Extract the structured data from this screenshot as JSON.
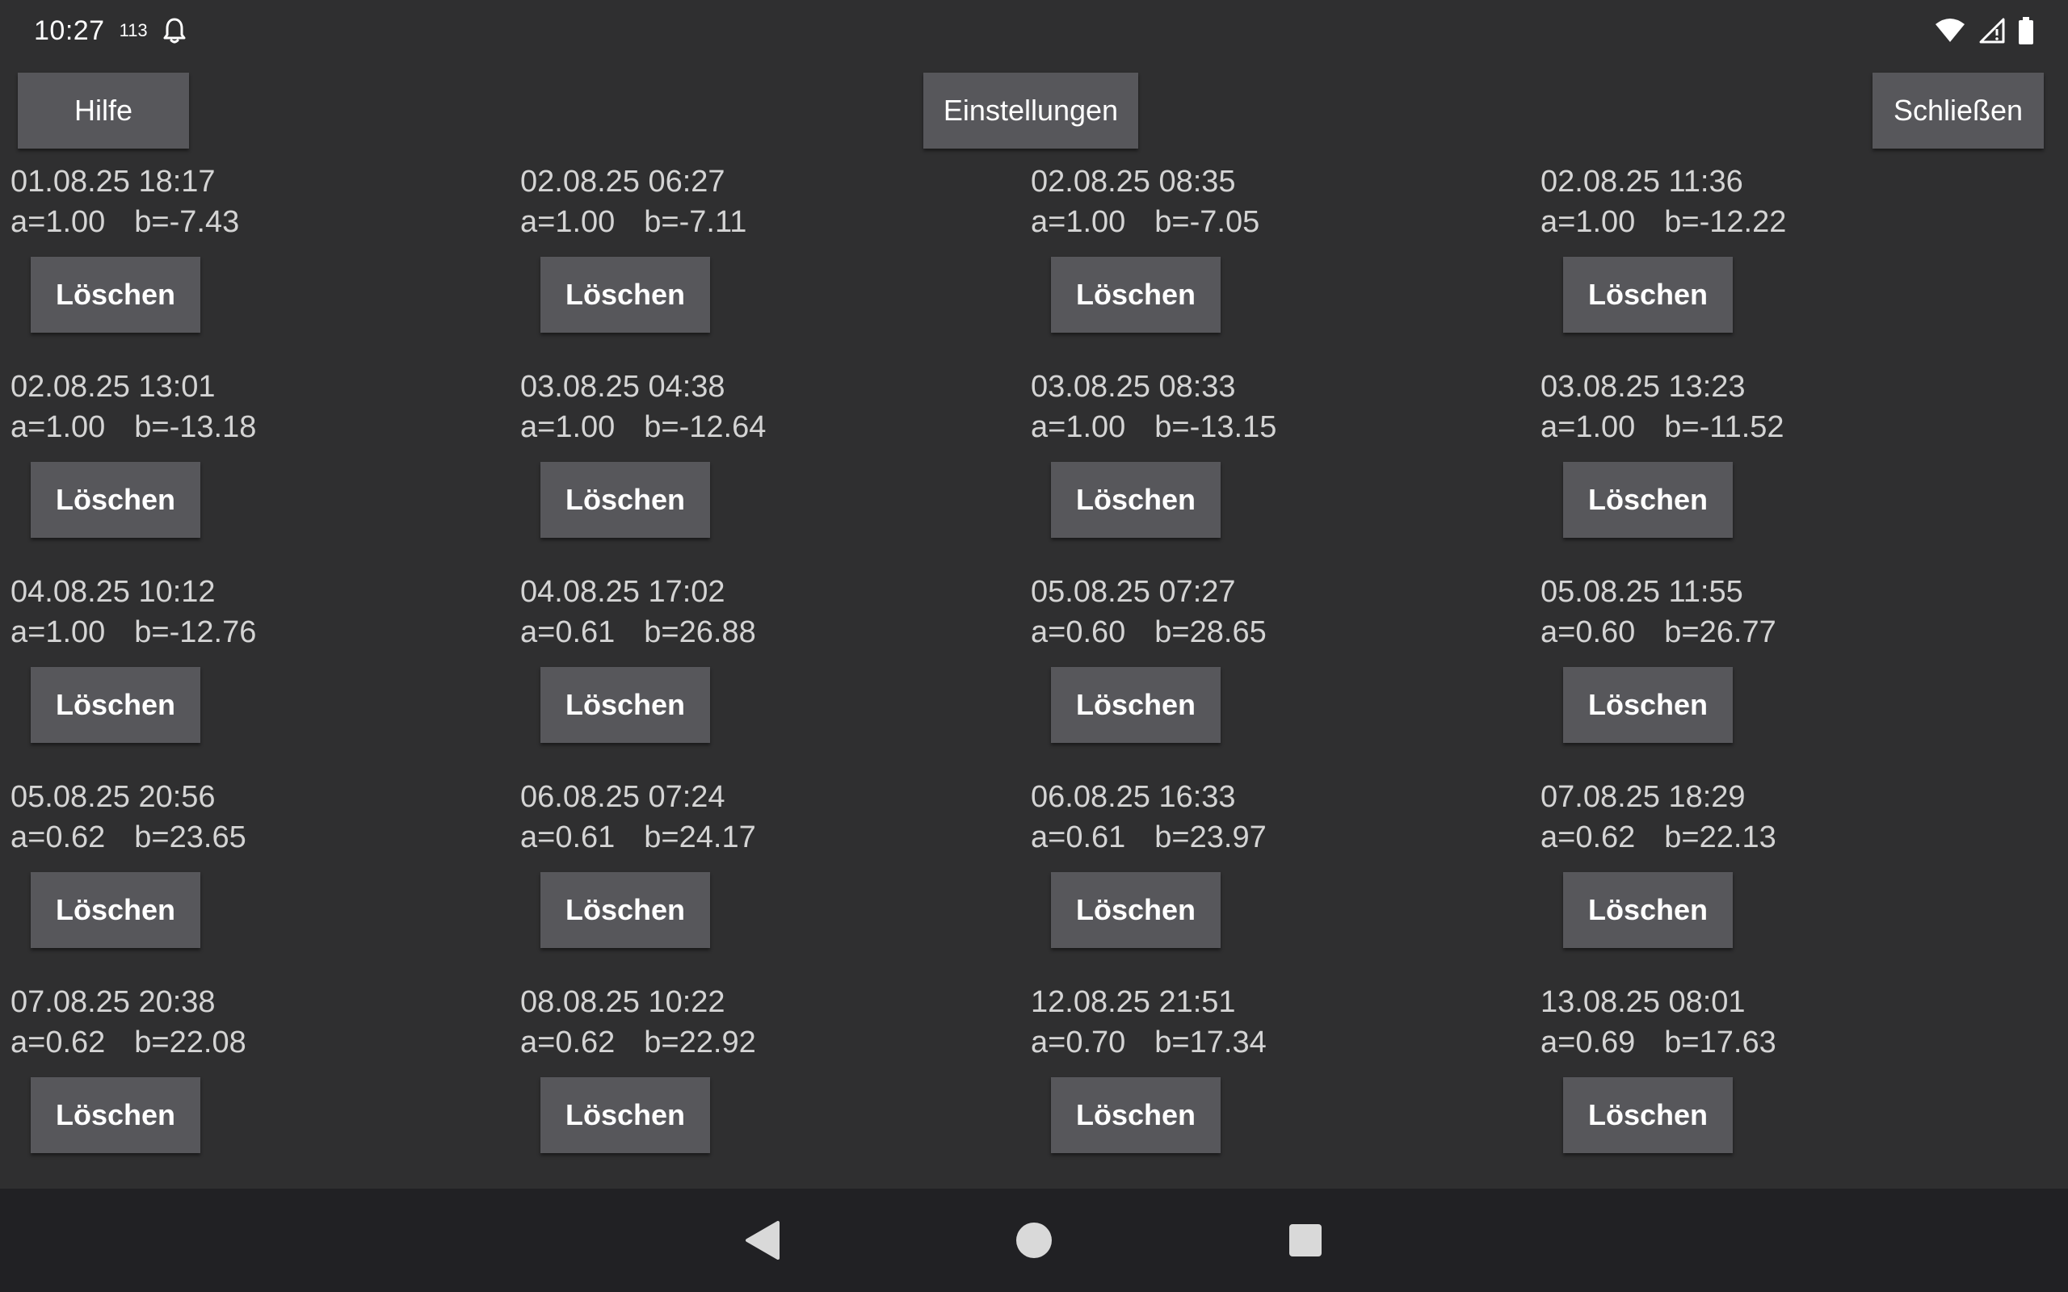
{
  "status_bar": {
    "time": "10:27",
    "count": "113",
    "icons": [
      "bell-icon",
      "wifi-icon",
      "cell-signal-icon",
      "battery-icon"
    ]
  },
  "toolbar": {
    "help_label": "Hilfe",
    "settings_label": "Einstellungen",
    "close_label": "Schließen"
  },
  "entries": [
    {
      "date": "01.08.25 18:17",
      "a": "a=1.00",
      "b": "b=-7.43",
      "delete_label": "Löschen"
    },
    {
      "date": "02.08.25 06:27",
      "a": "a=1.00",
      "b": "b=-7.11",
      "delete_label": "Löschen"
    },
    {
      "date": "02.08.25 08:35",
      "a": "a=1.00",
      "b": "b=-7.05",
      "delete_label": "Löschen"
    },
    {
      "date": "02.08.25 11:36",
      "a": "a=1.00",
      "b": "b=-12.22",
      "delete_label": "Löschen"
    },
    {
      "date": "02.08.25 13:01",
      "a": "a=1.00",
      "b": "b=-13.18",
      "delete_label": "Löschen"
    },
    {
      "date": "03.08.25 04:38",
      "a": "a=1.00",
      "b": "b=-12.64",
      "delete_label": "Löschen"
    },
    {
      "date": "03.08.25 08:33",
      "a": "a=1.00",
      "b": "b=-13.15",
      "delete_label": "Löschen"
    },
    {
      "date": "03.08.25 13:23",
      "a": "a=1.00",
      "b": "b=-11.52",
      "delete_label": "Löschen"
    },
    {
      "date": "04.08.25 10:12",
      "a": "a=1.00",
      "b": "b=-12.76",
      "delete_label": "Löschen"
    },
    {
      "date": "04.08.25 17:02",
      "a": "a=0.61",
      "b": "b=26.88",
      "delete_label": "Löschen"
    },
    {
      "date": "05.08.25 07:27",
      "a": "a=0.60",
      "b": "b=28.65",
      "delete_label": "Löschen"
    },
    {
      "date": "05.08.25 11:55",
      "a": "a=0.60",
      "b": "b=26.77",
      "delete_label": "Löschen"
    },
    {
      "date": "05.08.25 20:56",
      "a": "a=0.62",
      "b": "b=23.65",
      "delete_label": "Löschen"
    },
    {
      "date": "06.08.25 07:24",
      "a": "a=0.61",
      "b": "b=24.17",
      "delete_label": "Löschen"
    },
    {
      "date": "06.08.25 16:33",
      "a": "a=0.61",
      "b": "b=23.97",
      "delete_label": "Löschen"
    },
    {
      "date": "07.08.25 18:29",
      "a": "a=0.62",
      "b": "b=22.13",
      "delete_label": "Löschen"
    },
    {
      "date": "07.08.25 20:38",
      "a": "a=0.62",
      "b": "b=22.08",
      "delete_label": "Löschen"
    },
    {
      "date": "08.08.25 10:22",
      "a": "a=0.62",
      "b": "b=22.92",
      "delete_label": "Löschen"
    },
    {
      "date": "12.08.25 21:51",
      "a": "a=0.70",
      "b": "b=17.34",
      "delete_label": "Löschen"
    },
    {
      "date": "13.08.25 08:01",
      "a": "a=0.69",
      "b": "b=17.63",
      "delete_label": "Löschen"
    }
  ],
  "nav_bar": {
    "icons": [
      "back-icon",
      "home-icon",
      "recents-icon"
    ]
  }
}
